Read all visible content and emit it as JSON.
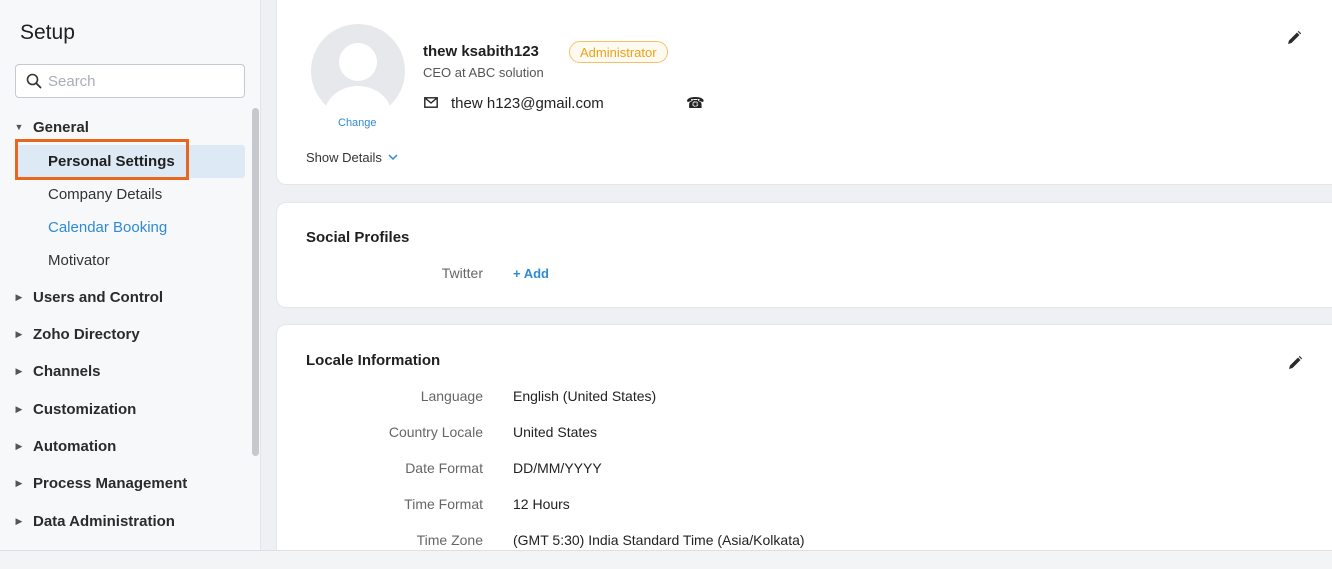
{
  "sidebar": {
    "title": "Setup",
    "search_placeholder": "Search",
    "groups": [
      {
        "label": "General",
        "expanded": true
      },
      {
        "label": "Users and Control"
      },
      {
        "label": "Zoho Directory"
      },
      {
        "label": "Channels"
      },
      {
        "label": "Customization"
      },
      {
        "label": "Automation"
      },
      {
        "label": "Process Management"
      },
      {
        "label": "Data Administration"
      }
    ],
    "general_items": [
      {
        "label": "Personal Settings",
        "active": true
      },
      {
        "label": "Company Details"
      },
      {
        "label": "Calendar Booking"
      },
      {
        "label": "Motivator"
      }
    ]
  },
  "profile": {
    "change_label": "Change",
    "name": "thew   ksabith123",
    "role": "Administrator",
    "title": "CEO at ABC solution",
    "email": "thew   h123@gmail.com",
    "show_details": "Show Details"
  },
  "social": {
    "title": "Social Profiles",
    "twitter_label": "Twitter",
    "add_label": "+ Add"
  },
  "locale": {
    "title": "Locale Information",
    "fields": [
      {
        "label": "Language",
        "value": "English (United States)"
      },
      {
        "label": "Country Locale",
        "value": "United States"
      },
      {
        "label": "Date Format",
        "value": "DD/MM/YYYY"
      },
      {
        "label": "Time Format",
        "value": "12 Hours"
      },
      {
        "label": "Time Zone",
        "value": "(GMT 5:30) India Standard Time (Asia/Kolkata)"
      }
    ]
  },
  "colors": {
    "accent": "#2f8ad5",
    "highlight": "#e8671f",
    "badge": "#e9a21c"
  }
}
